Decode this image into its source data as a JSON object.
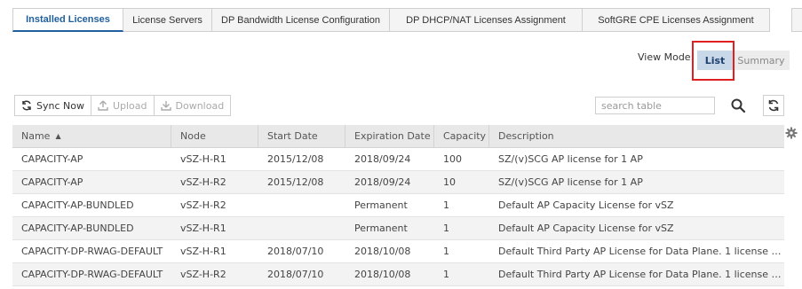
{
  "tabs": [
    {
      "label": "Installed Licenses",
      "active": true
    },
    {
      "label": "License Servers",
      "active": false
    },
    {
      "label": "DP Bandwidth License Configuration",
      "active": false
    },
    {
      "label": "DP DHCP/NAT Licenses Assignment",
      "active": false
    },
    {
      "label": "SoftGRE CPE Licenses Assignment",
      "active": false
    }
  ],
  "view_mode": {
    "label": "View Mode:",
    "options": [
      "List",
      "Summary"
    ],
    "selected": "List"
  },
  "toolbar": {
    "sync_now": "Sync Now",
    "upload": "Upload",
    "download": "Download"
  },
  "search": {
    "placeholder": "search table",
    "value": ""
  },
  "table": {
    "columns": [
      "Name",
      "Node",
      "Start Date",
      "Expiration Date",
      "Capacity",
      "Description"
    ],
    "sort_indicator": "▲",
    "rows": [
      [
        "CAPACITY-AP",
        "vSZ-H-R1",
        "2015/12/08",
        "2018/09/24",
        "100",
        "SZ/(v)SCG AP license for 1 AP"
      ],
      [
        "CAPACITY-AP",
        "vSZ-H-R2",
        "2015/12/08",
        "2018/09/24",
        "10",
        "SZ/(v)SCG AP license for 1 AP"
      ],
      [
        "CAPACITY-AP-BUNDLED",
        "vSZ-H-R2",
        "",
        "Permanent",
        "1",
        "Default AP Capacity License for vSZ"
      ],
      [
        "CAPACITY-AP-BUNDLED",
        "vSZ-H-R1",
        "",
        "Permanent",
        "1",
        "Default AP Capacity License for vSZ"
      ],
      [
        "CAPACITY-DP-RWAG-DEFAULT",
        "vSZ-H-R1",
        "2018/07/10",
        "2018/10/08",
        "1",
        "Default Third Party AP License for Data Plane. 1 license su..."
      ],
      [
        "CAPACITY-DP-RWAG-DEFAULT",
        "vSZ-H-R2",
        "2018/07/10",
        "2018/10/08",
        "1",
        "Default Third Party AP License for Data Plane. 1 license su..."
      ]
    ]
  },
  "colors": {
    "active_tab": "#1f5f9e",
    "list_button_bg": "#c9d8e8",
    "highlight": "#e02020"
  },
  "icons": [
    "sync-icon",
    "upload-icon",
    "download-icon",
    "search-icon",
    "refresh-icon",
    "gear-icon"
  ]
}
